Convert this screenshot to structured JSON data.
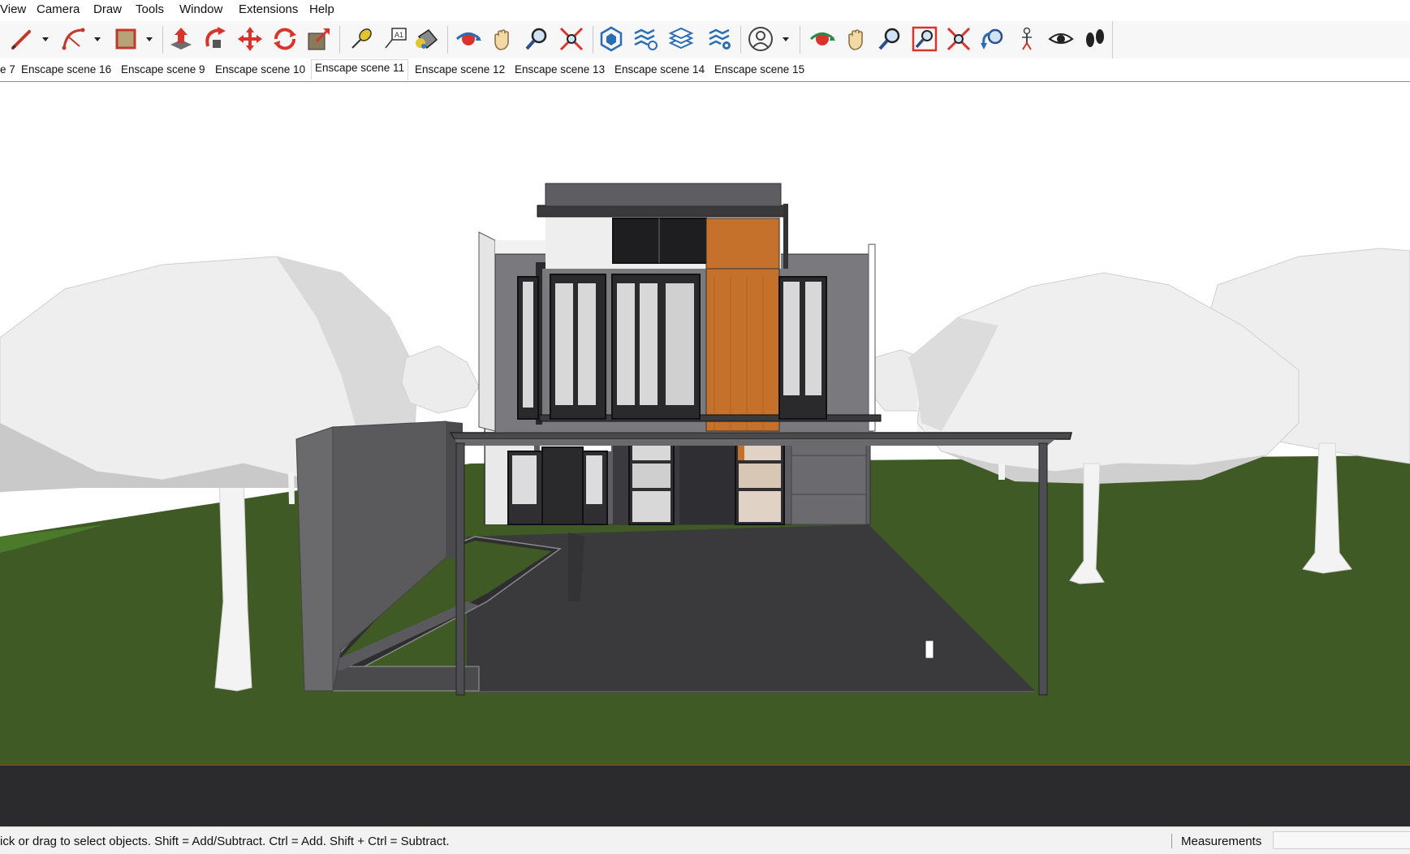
{
  "menu": {
    "items": [
      "View",
      "Camera",
      "Draw",
      "Tools",
      "Window",
      "Extensions",
      "Help"
    ]
  },
  "toolbar": {
    "tools": [
      "pencil-line-icon",
      "arc-icon",
      "rectangle-icon",
      "push-pull-icon",
      "follow-me-icon",
      "move-icon",
      "rotate-icon",
      "scale-icon",
      "tape-measure-icon",
      "text-icon",
      "paint-bucket-icon",
      "orbit-icon",
      "pan-hand-icon",
      "zoom-icon",
      "zoom-extents-icon",
      "component-icon",
      "layers-transfer-icon",
      "layers-stack-icon",
      "layers-settings-icon",
      "account-icon",
      "orbit-icon-2",
      "pan-hand-icon-2",
      "zoom-icon-2",
      "zoom-window-icon",
      "zoom-extents-icon-2",
      "previous-view-icon",
      "position-camera-icon",
      "look-around-eye-icon",
      "walk-footprints-icon"
    ]
  },
  "scenes": {
    "tabs": [
      "e 7",
      "Enscape scene 16",
      "Enscape scene 9",
      "Enscape scene 10",
      "Enscape scene 11",
      "Enscape scene 12",
      "Enscape scene 13",
      "Enscape scene 14",
      "Enscape scene 15"
    ],
    "active_index": 4
  },
  "status": {
    "hint": "ick or drag to select objects. Shift = Add/Subtract. Ctrl = Add. Shift + Ctrl = Subtract.",
    "measurements_label": "Measurements",
    "measurements_value": ""
  },
  "colors": {
    "sky": "#ffffff",
    "grass": "#3f5a24",
    "wall_dark": "#4e4e52",
    "wall_mid": "#767679",
    "wood_accent": "#c6712b",
    "trees": "#ececec",
    "ground_band": "#2b2a2d"
  }
}
